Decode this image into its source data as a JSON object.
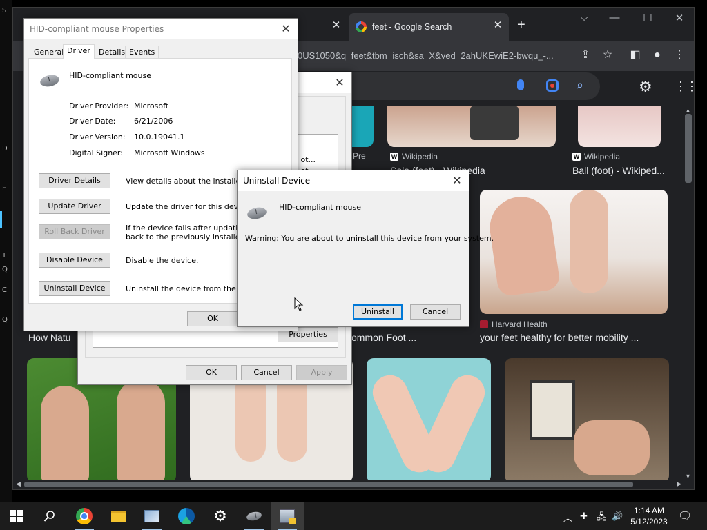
{
  "desktop": {
    "edge_marks": [
      "S",
      "D",
      "E",
      "T",
      "Q",
      "C",
      "Q"
    ]
  },
  "browser": {
    "tabs": [
      {
        "label": "feet - Google Search"
      }
    ],
    "url": "0US1050&q=feet&tbm=isch&sa=X&ved=2ahUKEwiE2-bwqu_-...",
    "results": [
      {
        "source": "Wikipedia",
        "title": "Sole (foot) - Wikipedia"
      },
      {
        "source": "Wikipedia",
        "title": "Ball (foot) - Wikiped..."
      },
      {
        "source": "Harvard Health",
        "title": "your feet healthy for better mobility ..."
      },
      {
        "partial_title": "ommon Foot ..."
      },
      {
        "partial_title": "How Natu",
        "partial_source": "Pre"
      }
    ]
  },
  "properties_dialog": {
    "title": "HID-compliant mouse Properties",
    "tabs": [
      "General",
      "Driver",
      "Details",
      "Events"
    ],
    "device_name": "HID-compliant mouse",
    "fields": [
      {
        "label": "Driver Provider:",
        "value": "Microsoft"
      },
      {
        "label": "Driver Date:",
        "value": "6/21/2006"
      },
      {
        "label": "Driver Version:",
        "value": "10.0.19041.1"
      },
      {
        "label": "Digital Signer:",
        "value": "Microsoft Windows"
      }
    ],
    "actions": [
      {
        "button": "Driver Details",
        "desc": "View details about the installed driv"
      },
      {
        "button": "Update Driver",
        "desc": "Update the driver for this device."
      },
      {
        "button": "Roll Back Driver",
        "desc": "If the device fails after updating the\nback to the previously installed driv"
      },
      {
        "button": "Disable Device",
        "desc": "Disable the device."
      },
      {
        "button": "Uninstall Device",
        "desc": "Uninstall the device from the syster"
      }
    ],
    "ok": "OK"
  },
  "back_dialog": {
    "list_fragments": [
      "d ot...",
      "d ot"
    ],
    "properties_button": "Properties",
    "ok": "OK",
    "cancel": "Cancel",
    "apply": "Apply"
  },
  "uninstall_dialog": {
    "title": "Uninstall Device",
    "device_name": "HID-compliant mouse",
    "warning": "Warning: You are about to uninstall this device from your system.",
    "uninstall": "Uninstall",
    "cancel": "Cancel"
  },
  "taskbar": {
    "time": "1:14 AM",
    "date": "5/12/2023"
  }
}
